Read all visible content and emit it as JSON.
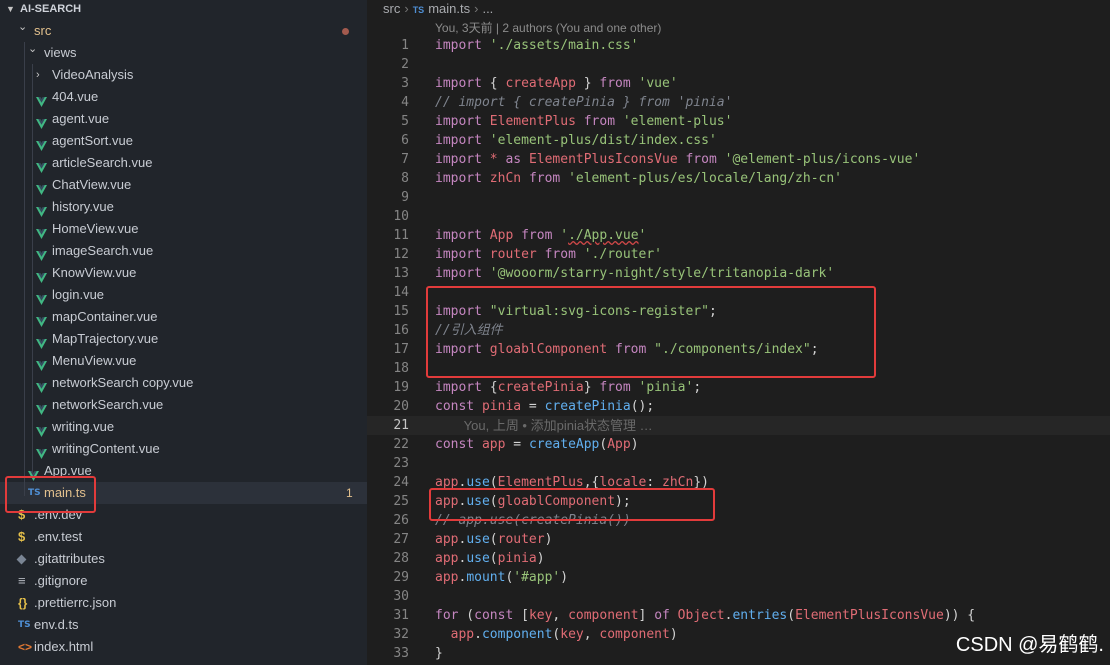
{
  "explorer": {
    "project_title": "AI-SEARCH",
    "items": [
      {
        "label": "src",
        "kind": "folder-open",
        "depth": 1,
        "modified": true,
        "badge": "dot"
      },
      {
        "label": "views",
        "kind": "folder-open",
        "depth": 2
      },
      {
        "label": "VideoAnalysis",
        "kind": "folder-closed",
        "depth": 3
      },
      {
        "label": "404.vue",
        "kind": "vue",
        "depth": 3
      },
      {
        "label": "agent.vue",
        "kind": "vue",
        "depth": 3
      },
      {
        "label": "agentSort.vue",
        "kind": "vue",
        "depth": 3
      },
      {
        "label": "articleSearch.vue",
        "kind": "vue",
        "depth": 3
      },
      {
        "label": "ChatView.vue",
        "kind": "vue",
        "depth": 3
      },
      {
        "label": "history.vue",
        "kind": "vue",
        "depth": 3
      },
      {
        "label": "HomeView.vue",
        "kind": "vue",
        "depth": 3
      },
      {
        "label": "imageSearch.vue",
        "kind": "vue",
        "depth": 3
      },
      {
        "label": "KnowView.vue",
        "kind": "vue",
        "depth": 3
      },
      {
        "label": "login.vue",
        "kind": "vue",
        "depth": 3
      },
      {
        "label": "mapContainer.vue",
        "kind": "vue",
        "depth": 3
      },
      {
        "label": "MapTrajectory.vue",
        "kind": "vue",
        "depth": 3
      },
      {
        "label": "MenuView.vue",
        "kind": "vue",
        "depth": 3
      },
      {
        "label": "networkSearch copy.vue",
        "kind": "vue",
        "depth": 3
      },
      {
        "label": "networkSearch.vue",
        "kind": "vue",
        "depth": 3
      },
      {
        "label": "writing.vue",
        "kind": "vue",
        "depth": 3
      },
      {
        "label": "writingContent.vue",
        "kind": "vue",
        "depth": 3
      },
      {
        "label": "App.vue",
        "kind": "vue",
        "depth": 2
      },
      {
        "label": "main.ts",
        "kind": "ts",
        "depth": 2,
        "selected": true,
        "modified": true,
        "badge": "1"
      },
      {
        "label": ".env.dev",
        "kind": "env",
        "depth": 1
      },
      {
        "label": ".env.test",
        "kind": "env",
        "depth": 1
      },
      {
        "label": ".gitattributes",
        "kind": "git",
        "depth": 1
      },
      {
        "label": ".gitignore",
        "kind": "lines",
        "depth": 1
      },
      {
        "label": ".prettierrc.json",
        "kind": "json",
        "depth": 1
      },
      {
        "label": "env.d.ts",
        "kind": "ts",
        "depth": 1
      },
      {
        "label": "index.html",
        "kind": "html",
        "depth": 1
      }
    ]
  },
  "breadcrumb": {
    "folder": "src",
    "ts_badge": "TS",
    "file": "main.ts",
    "more": "..."
  },
  "codelens": "You, 3天前 | 2 authors (You and one other)",
  "editor": {
    "active_line": "21",
    "lines": [
      {
        "n": "1",
        "t": [
          [
            "kw",
            "import"
          ],
          [
            "plain",
            " "
          ],
          [
            "str",
            "'./assets/main.css'"
          ]
        ]
      },
      {
        "n": "2",
        "t": []
      },
      {
        "n": "3",
        "t": [
          [
            "kw",
            "import"
          ],
          [
            "plain",
            " { "
          ],
          [
            "var",
            "createApp"
          ],
          [
            "plain",
            " } "
          ],
          [
            "kw",
            "from"
          ],
          [
            "plain",
            " "
          ],
          [
            "str",
            "'vue'"
          ]
        ]
      },
      {
        "n": "4",
        "t": [
          [
            "cmt",
            "// import { createPinia } from 'pinia'"
          ]
        ]
      },
      {
        "n": "5",
        "t": [
          [
            "kw",
            "import"
          ],
          [
            "plain",
            " "
          ],
          [
            "var",
            "ElementPlus"
          ],
          [
            "plain",
            " "
          ],
          [
            "kw",
            "from"
          ],
          [
            "plain",
            " "
          ],
          [
            "str",
            "'element-plus'"
          ]
        ]
      },
      {
        "n": "6",
        "t": [
          [
            "kw",
            "import"
          ],
          [
            "plain",
            " "
          ],
          [
            "str",
            "'element-plus/dist/index.css'"
          ]
        ]
      },
      {
        "n": "7",
        "t": [
          [
            "kw",
            "import"
          ],
          [
            "plain",
            " "
          ],
          [
            "var",
            "*"
          ],
          [
            "plain",
            " "
          ],
          [
            "kw",
            "as"
          ],
          [
            "plain",
            " "
          ],
          [
            "var",
            "ElementPlusIconsVue"
          ],
          [
            "plain",
            " "
          ],
          [
            "kw",
            "from"
          ],
          [
            "plain",
            " "
          ],
          [
            "str",
            "'@element-plus/icons-vue'"
          ]
        ]
      },
      {
        "n": "8",
        "t": [
          [
            "kw",
            "import"
          ],
          [
            "plain",
            " "
          ],
          [
            "var",
            "zhCn"
          ],
          [
            "plain",
            " "
          ],
          [
            "kw",
            "from"
          ],
          [
            "plain",
            " "
          ],
          [
            "str",
            "'element-plus/es/locale/lang/zh-cn'"
          ]
        ]
      },
      {
        "n": "9",
        "t": []
      },
      {
        "n": "10",
        "t": []
      },
      {
        "n": "11",
        "t": [
          [
            "kw",
            "import"
          ],
          [
            "plain",
            " "
          ],
          [
            "var",
            "App"
          ],
          [
            "plain",
            " "
          ],
          [
            "kw",
            "from"
          ],
          [
            "plain",
            " "
          ],
          [
            "str",
            "'"
          ],
          [
            "squig",
            "./App.vue"
          ],
          [
            "str",
            "'"
          ]
        ]
      },
      {
        "n": "12",
        "t": [
          [
            "kw",
            "import"
          ],
          [
            "plain",
            " "
          ],
          [
            "var",
            "router"
          ],
          [
            "plain",
            " "
          ],
          [
            "kw",
            "from"
          ],
          [
            "plain",
            " "
          ],
          [
            "str",
            "'./router'"
          ]
        ]
      },
      {
        "n": "13",
        "t": [
          [
            "kw",
            "import"
          ],
          [
            "plain",
            " "
          ],
          [
            "str",
            "'@wooorm/starry-night/style/tritanopia-dark'"
          ]
        ]
      },
      {
        "n": "14",
        "t": []
      },
      {
        "n": "15",
        "t": [
          [
            "kw",
            "import"
          ],
          [
            "plain",
            " "
          ],
          [
            "str",
            "\"virtual:svg-icons-register\""
          ],
          [
            "plain",
            ";"
          ]
        ]
      },
      {
        "n": "16",
        "t": [
          [
            "cmt",
            "//引入组件"
          ]
        ]
      },
      {
        "n": "17",
        "t": [
          [
            "kw",
            "import"
          ],
          [
            "plain",
            " "
          ],
          [
            "var",
            "gloablComponent"
          ],
          [
            "plain",
            " "
          ],
          [
            "kw",
            "from"
          ],
          [
            "plain",
            " "
          ],
          [
            "str",
            "\"./components/index\""
          ],
          [
            "plain",
            ";"
          ]
        ]
      },
      {
        "n": "18",
        "t": []
      },
      {
        "n": "19",
        "t": [
          [
            "kw",
            "import"
          ],
          [
            "plain",
            " {"
          ],
          [
            "var",
            "createPinia"
          ],
          [
            "plain",
            "} "
          ],
          [
            "kw",
            "from"
          ],
          [
            "plain",
            " "
          ],
          [
            "str",
            "'pinia'"
          ],
          [
            "plain",
            ";"
          ]
        ]
      },
      {
        "n": "20",
        "t": [
          [
            "kw",
            "const"
          ],
          [
            "plain",
            " "
          ],
          [
            "var",
            "pinia"
          ],
          [
            "plain",
            " = "
          ],
          [
            "fn",
            "createPinia"
          ],
          [
            "plain",
            "();"
          ]
        ]
      },
      {
        "n": "21",
        "t": [
          [
            "ghost",
            "        You, 上周 • 添加pinia状态管理 …"
          ]
        ]
      },
      {
        "n": "22",
        "t": [
          [
            "kw",
            "const"
          ],
          [
            "plain",
            " "
          ],
          [
            "var",
            "app"
          ],
          [
            "plain",
            " = "
          ],
          [
            "fn",
            "createApp"
          ],
          [
            "plain",
            "("
          ],
          [
            "var",
            "App"
          ],
          [
            "plain",
            ")"
          ]
        ]
      },
      {
        "n": "23",
        "t": []
      },
      {
        "n": "24",
        "t": [
          [
            "var",
            "app"
          ],
          [
            "plain",
            "."
          ],
          [
            "fn",
            "use"
          ],
          [
            "plain",
            "("
          ],
          [
            "var",
            "ElementPlus"
          ],
          [
            "plain",
            ",{"
          ],
          [
            "var",
            "locale"
          ],
          [
            "plain",
            ": "
          ],
          [
            "var",
            "zhCn"
          ],
          [
            "plain",
            "})"
          ]
        ]
      },
      {
        "n": "25",
        "t": [
          [
            "var",
            "app"
          ],
          [
            "plain",
            "."
          ],
          [
            "fn",
            "use"
          ],
          [
            "plain",
            "("
          ],
          [
            "var",
            "gloablComponent"
          ],
          [
            "plain",
            ");"
          ]
        ]
      },
      {
        "n": "26",
        "t": [
          [
            "cmt",
            "// app.use(createPinia())"
          ]
        ]
      },
      {
        "n": "27",
        "t": [
          [
            "var",
            "app"
          ],
          [
            "plain",
            "."
          ],
          [
            "fn",
            "use"
          ],
          [
            "plain",
            "("
          ],
          [
            "var",
            "router"
          ],
          [
            "plain",
            ")"
          ]
        ]
      },
      {
        "n": "28",
        "t": [
          [
            "var",
            "app"
          ],
          [
            "plain",
            "."
          ],
          [
            "fn",
            "use"
          ],
          [
            "plain",
            "("
          ],
          [
            "var",
            "pinia"
          ],
          [
            "plain",
            ")"
          ]
        ]
      },
      {
        "n": "29",
        "t": [
          [
            "var",
            "app"
          ],
          [
            "plain",
            "."
          ],
          [
            "fn",
            "mount"
          ],
          [
            "plain",
            "("
          ],
          [
            "str",
            "'#app'"
          ],
          [
            "plain",
            ")"
          ]
        ]
      },
      {
        "n": "30",
        "t": []
      },
      {
        "n": "31",
        "t": [
          [
            "kw",
            "for"
          ],
          [
            "plain",
            " ("
          ],
          [
            "kw",
            "const"
          ],
          [
            "plain",
            " ["
          ],
          [
            "var",
            "key"
          ],
          [
            "plain",
            ", "
          ],
          [
            "var",
            "component"
          ],
          [
            "plain",
            "] "
          ],
          [
            "kw",
            "of"
          ],
          [
            "plain",
            " "
          ],
          [
            "var",
            "Object"
          ],
          [
            "plain",
            "."
          ],
          [
            "fn",
            "entries"
          ],
          [
            "plain",
            "("
          ],
          [
            "var",
            "ElementPlusIconsVue"
          ],
          [
            "plain",
            ")) {"
          ]
        ]
      },
      {
        "n": "32",
        "t": [
          [
            "plain",
            "  "
          ],
          [
            "var",
            "app"
          ],
          [
            "plain",
            "."
          ],
          [
            "fn",
            "component"
          ],
          [
            "plain",
            "("
          ],
          [
            "var",
            "key"
          ],
          [
            "plain",
            ", "
          ],
          [
            "var",
            "component"
          ],
          [
            "plain",
            ")"
          ]
        ]
      },
      {
        "n": "33",
        "t": [
          [
            "plain",
            "}"
          ]
        ]
      }
    ]
  },
  "watermark": "CSDN @易鹤鹤.",
  "colors": {
    "vue_green": "#41b883",
    "highlight_red": "#e23b3b",
    "modified": "#e2c08d"
  }
}
